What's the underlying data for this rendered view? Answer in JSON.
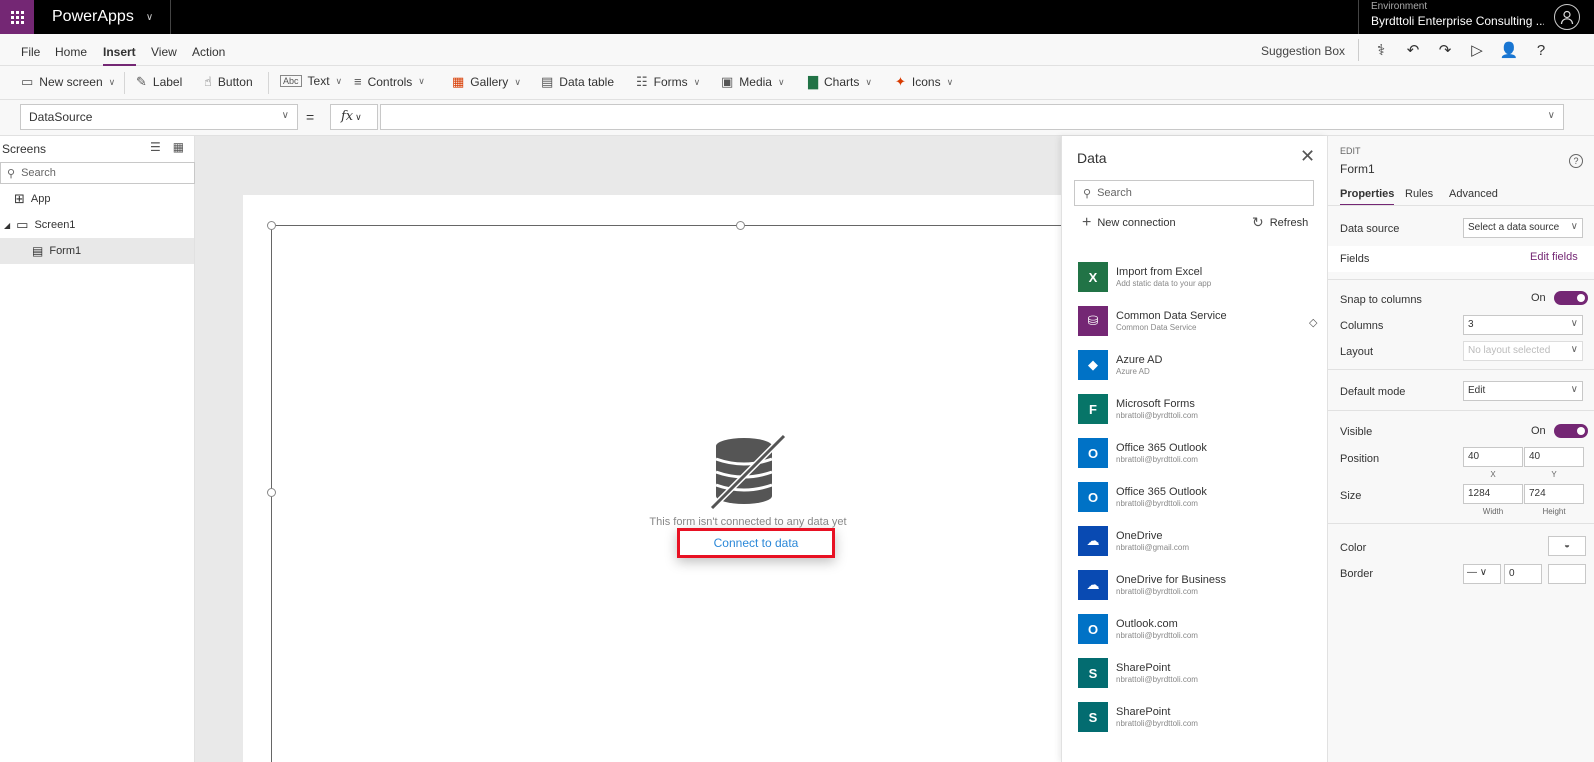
{
  "topbar": {
    "app_name": "PowerApps",
    "environment_label": "Environment",
    "environment_value": "Byrdttoli Enterprise Consulting ..."
  },
  "menu": {
    "items": [
      "File",
      "Home",
      "Insert",
      "View",
      "Action"
    ],
    "active": "Insert",
    "suggestion_box": "Suggestion Box"
  },
  "ribbon": {
    "new_screen": "New screen",
    "label": "Label",
    "button": "Button",
    "text": "Text",
    "controls": "Controls",
    "gallery": "Gallery",
    "data_table": "Data table",
    "forms": "Forms",
    "media": "Media",
    "charts": "Charts",
    "icons": "Icons"
  },
  "formula": {
    "property": "DataSource",
    "equals": "=",
    "fx": "fx",
    "value": ""
  },
  "left_panel": {
    "title": "Screens",
    "search_placeholder": "Search",
    "tree": [
      {
        "label": "App",
        "icon": "app-icon"
      },
      {
        "label": "Screen1",
        "icon": "screen-icon"
      },
      {
        "label": "Form1",
        "icon": "form-icon",
        "selected": true
      }
    ]
  },
  "canvas": {
    "empty_message": "This form isn't connected to any data yet",
    "connect_link": "Connect to data"
  },
  "data_pane": {
    "title": "Data",
    "search_placeholder": "Search",
    "new_connection": "New connection",
    "refresh": "Refresh",
    "connections": [
      {
        "name": "Import from Excel",
        "sub": "Add static data to your app",
        "color": "#217346",
        "icon": "excel-icon"
      },
      {
        "name": "Common Data Service",
        "sub": "Common Data Service",
        "color": "#742774",
        "icon": "cds-icon"
      },
      {
        "name": "Azure AD",
        "sub": "Azure AD",
        "color": "#0072c6",
        "icon": "azure-ad-icon"
      },
      {
        "name": "Microsoft Forms",
        "sub": "nbrattoli@byrdttoli.com",
        "color": "#077568",
        "icon": "forms-icon"
      },
      {
        "name": "Office 365 Outlook",
        "sub": "nbrattoli@byrdttoli.com",
        "color": "#0072c6",
        "icon": "outlook-icon"
      },
      {
        "name": "Office 365 Outlook",
        "sub": "nbrattoli@byrdttoli.com",
        "color": "#0072c6",
        "icon": "outlook-icon"
      },
      {
        "name": "OneDrive",
        "sub": "nbrattoli@gmail.com",
        "color": "#094ab2",
        "icon": "onedrive-icon"
      },
      {
        "name": "OneDrive for Business",
        "sub": "nbrattoli@byrdttoli.com",
        "color": "#094ab2",
        "icon": "onedrive-icon"
      },
      {
        "name": "Outlook.com",
        "sub": "nbrattoli@byrdttoli.com",
        "color": "#0072c6",
        "icon": "outlook-icon"
      },
      {
        "name": "SharePoint",
        "sub": "nbrattoli@byrdttoli.com",
        "color": "#036c70",
        "icon": "sharepoint-icon"
      },
      {
        "name": "SharePoint",
        "sub": "nbrattoli@byrdttoli.com",
        "color": "#036c70",
        "icon": "sharepoint-icon"
      }
    ]
  },
  "properties": {
    "edit_label": "EDIT",
    "control_name": "Form1",
    "tabs": [
      "Properties",
      "Rules",
      "Advanced"
    ],
    "active_tab": "Properties",
    "data_source_label": "Data source",
    "data_source_value": "Select a data source",
    "fields_label": "Fields",
    "edit_fields": "Edit fields",
    "snap_label": "Snap to columns",
    "snap_value": "On",
    "columns_label": "Columns",
    "columns_value": "3",
    "layout_label": "Layout",
    "layout_value": "No layout selected",
    "default_mode_label": "Default mode",
    "default_mode_value": "Edit",
    "visible_label": "Visible",
    "visible_value": "On",
    "position_label": "Position",
    "pos_x": "40",
    "pos_y": "40",
    "x_caption": "X",
    "y_caption": "Y",
    "size_label": "Size",
    "width": "1284",
    "height": "724",
    "width_caption": "Width",
    "height_caption": "Height",
    "color_label": "Color",
    "border_label": "Border",
    "border_width": "0"
  },
  "colors": {
    "brand": "#742774",
    "highlight": "#e81123",
    "link": "#2b88d8"
  }
}
